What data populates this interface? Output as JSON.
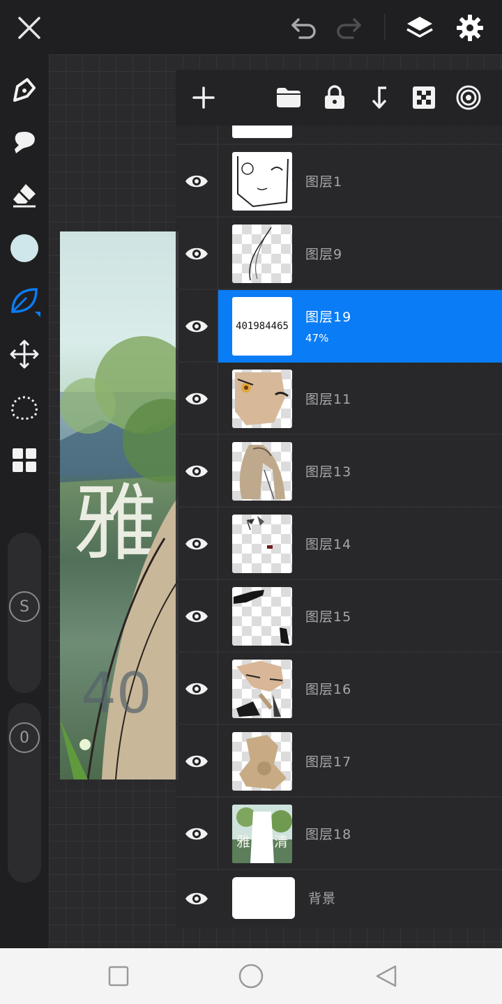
{
  "colors": {
    "accent": "#0a7cf5",
    "current_color": "#cfe6ea"
  },
  "layers": [
    {
      "name": "图层1",
      "visible": true,
      "thumb": "face-lineart"
    },
    {
      "name": "图层9",
      "visible": true,
      "thumb": "strands"
    },
    {
      "name": "图层19",
      "visible": true,
      "selected": true,
      "opacity": "47%",
      "thumb_text": "401984465"
    },
    {
      "name": "图层11",
      "visible": true,
      "thumb": "face-color"
    },
    {
      "name": "图层13",
      "visible": true,
      "thumb": "figure"
    },
    {
      "name": "图层14",
      "visible": true,
      "thumb": "small-marks"
    },
    {
      "name": "图层15",
      "visible": true,
      "thumb": "dark-shapes"
    },
    {
      "name": "图层16",
      "visible": true,
      "thumb": "figure-color"
    },
    {
      "name": "图层17",
      "visible": true,
      "thumb": "tan-blob"
    },
    {
      "name": "图层18",
      "visible": true,
      "thumb": "background-art"
    },
    {
      "name": "背景",
      "visible": true,
      "thumb": "white"
    }
  ],
  "sliders": {
    "size_label": "S",
    "opacity_label": "0"
  },
  "icons": {
    "close": "close-icon",
    "undo": "undo-icon",
    "redo": "redo-icon",
    "layers": "layers-icon",
    "settings": "gear-icon",
    "add": "plus-icon",
    "folder": "folder-icon",
    "lock": "lock-icon",
    "merge": "merge-down-icon",
    "alpha": "checker-icon",
    "blend": "blend-icon"
  }
}
